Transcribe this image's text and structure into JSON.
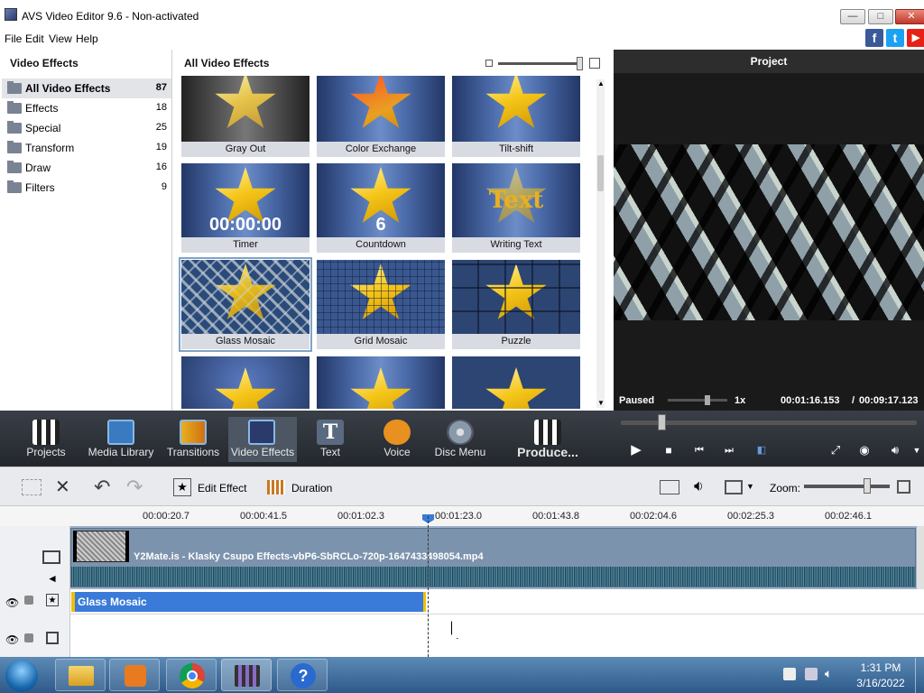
{
  "window": {
    "title": "AVS Video Editor 9.6 - Non-activated",
    "controls": {
      "minimize": "—",
      "maximize": "□",
      "close": "✕"
    }
  },
  "menu": [
    "File",
    "Edit",
    "View",
    "Help"
  ],
  "social": {
    "facebook": "f",
    "twitter": "t",
    "youtube": "▶",
    "colors": {
      "facebook": "#3b5998",
      "twitter": "#1da1f2",
      "youtube": "#e62117"
    }
  },
  "left_panel": {
    "header": "Video Effects",
    "categories": [
      {
        "label": "All Video Effects",
        "count": "87"
      },
      {
        "label": "Effects",
        "count": "18"
      },
      {
        "label": "Special",
        "count": "25"
      },
      {
        "label": "Transform",
        "count": "19"
      },
      {
        "label": "Draw",
        "count": "16"
      },
      {
        "label": "Filters",
        "count": "9"
      }
    ]
  },
  "center_panel": {
    "header": "All Video Effects",
    "tiles": [
      {
        "label": "Gray Out"
      },
      {
        "label": "Color Exchange"
      },
      {
        "label": "Tilt-shift"
      },
      {
        "label": "Timer",
        "overlay": "00:00:00"
      },
      {
        "label": "Countdown",
        "overlay": "6"
      },
      {
        "label": "Writing Text",
        "overlay": "Text"
      },
      {
        "label": "Glass Mosaic"
      },
      {
        "label": "Grid Mosaic"
      },
      {
        "label": "Puzzle"
      }
    ]
  },
  "preview": {
    "header": "Project",
    "status": "Paused",
    "speed": "1x",
    "time": "00:01:16.153",
    "separator": "/",
    "duration": "00:09:17.123"
  },
  "toolbar": [
    "Projects",
    "Media Library",
    "Transitions",
    "Video Effects",
    "Text",
    "Voice",
    "Disc Menu"
  ],
  "produce": "Produce...",
  "timeline_toolbar": {
    "edit_effect": "Edit Effect",
    "duration": "Duration",
    "zoom": "Zoom:"
  },
  "ruler": [
    "00:00:20.7",
    "00:00:41.5",
    "00:01:02.3",
    "00:01:23.0",
    "00:01:43.8",
    "00:02:04.6",
    "00:02:25.3",
    "00:02:46.1"
  ],
  "timeline": {
    "clip_name": "Y2Mate.is - Klasky Csupo Effects-vbP6-SbRCLo-720p-1647433498054.mp4",
    "effect_name": "Glass Mosaic"
  },
  "taskbar": {
    "time": "1:31 PM",
    "date": "3/16/2022"
  },
  "colors": {
    "accent": "#3a7ad8",
    "toolbar": "#2b3038",
    "taskbar": "#3f6d9c"
  }
}
